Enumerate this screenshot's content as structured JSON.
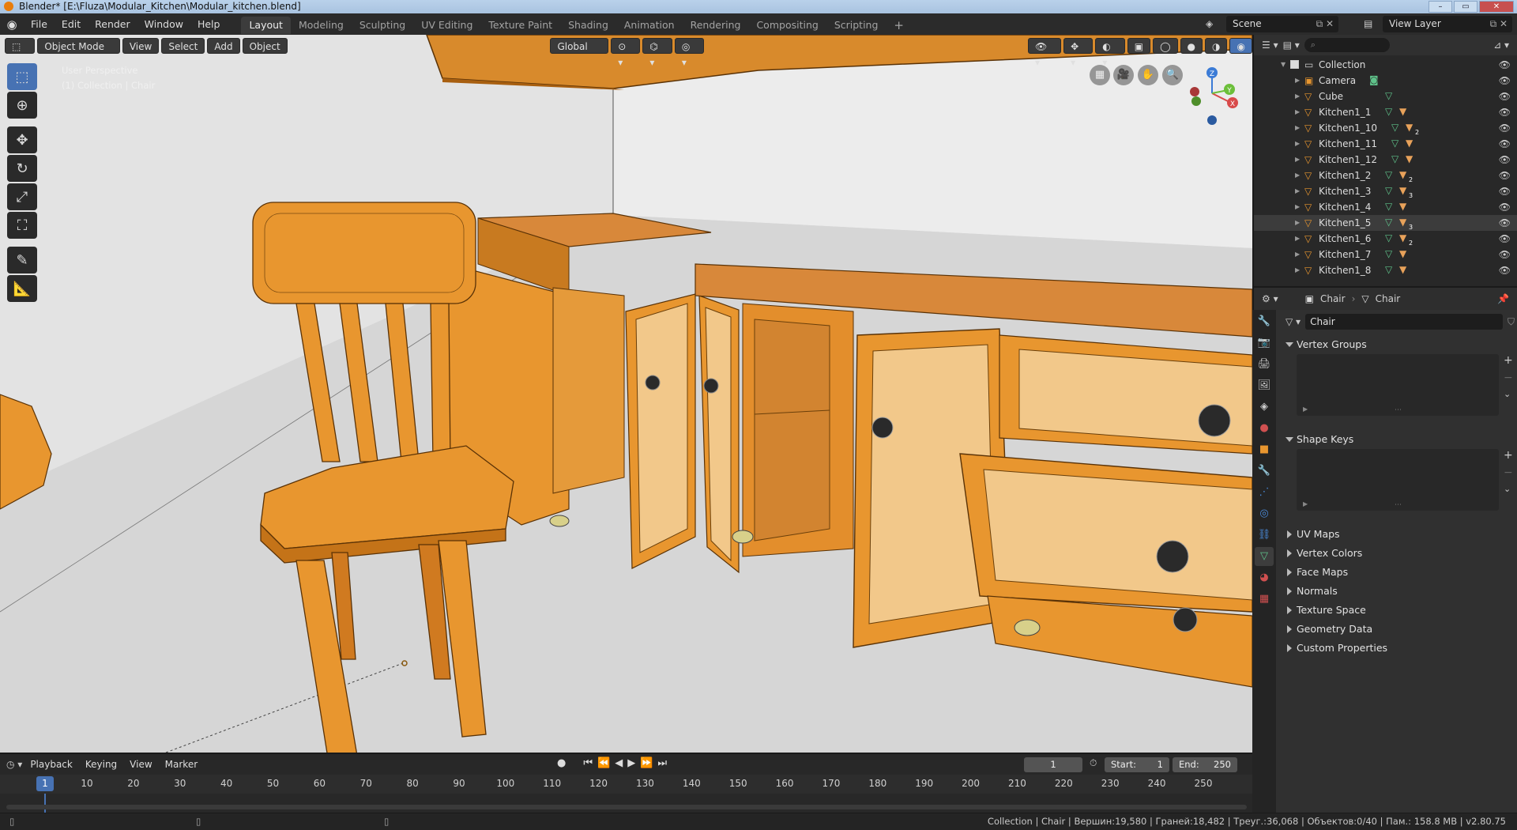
{
  "window": {
    "title": "Blender* [E:\\Fluza\\Modular_Kitchen\\Modular_kitchen.blend]"
  },
  "menus": [
    "File",
    "Edit",
    "Render",
    "Window",
    "Help"
  ],
  "workspaces": [
    {
      "label": "Layout",
      "active": true
    },
    {
      "label": "Modeling"
    },
    {
      "label": "Sculpting"
    },
    {
      "label": "UV Editing"
    },
    {
      "label": "Texture Paint"
    },
    {
      "label": "Shading"
    },
    {
      "label": "Animation"
    },
    {
      "label": "Rendering"
    },
    {
      "label": "Compositing"
    },
    {
      "label": "Scripting"
    }
  ],
  "add_workspace": "+",
  "scene": {
    "name": "Scene",
    "view_layer": "View Layer"
  },
  "viewport": {
    "mode": "Object Mode",
    "menus": [
      "View",
      "Select",
      "Add",
      "Object"
    ],
    "orientation": "Global",
    "overlay_text_1": "User Perspective",
    "overlay_text_2": "(1) Collection | Chair",
    "gizmo_axes": {
      "x": "X",
      "y": "Y",
      "z": "Z"
    },
    "colors": {
      "wood": "#e8962f",
      "wood_dark": "#b86a14",
      "wood_light": "#f2c88a",
      "floor": "#d4d4d4",
      "wall": "#e6e6e6"
    }
  },
  "outliner": {
    "search_placeholder": "",
    "collection": "Collection",
    "items": [
      {
        "label": "Camera",
        "type": "camera"
      },
      {
        "label": "Cube",
        "type": "mesh"
      },
      {
        "label": "Kitchen1_1",
        "type": "mesh",
        "mods": ""
      },
      {
        "label": "Kitchen1_10",
        "type": "mesh",
        "mods": "2"
      },
      {
        "label": "Kitchen1_11",
        "type": "mesh",
        "mods": ""
      },
      {
        "label": "Kitchen1_12",
        "type": "mesh",
        "mods": ""
      },
      {
        "label": "Kitchen1_2",
        "type": "mesh",
        "mods": "2"
      },
      {
        "label": "Kitchen1_3",
        "type": "mesh",
        "mods": "3"
      },
      {
        "label": "Kitchen1_4",
        "type": "mesh",
        "mods": ""
      },
      {
        "label": "Kitchen1_5",
        "type": "mesh",
        "mods": "3",
        "selected": true
      },
      {
        "label": "Kitchen1_6",
        "type": "mesh",
        "mods": "2"
      },
      {
        "label": "Kitchen1_7",
        "type": "mesh",
        "mods": ""
      },
      {
        "label": "Kitchen1_8",
        "type": "mesh",
        "mods": ""
      }
    ]
  },
  "properties": {
    "breadcrumb_object": "Chair",
    "breadcrumb_data": "Chair",
    "data_name": "Chair",
    "panels": [
      {
        "label": "Vertex Groups",
        "open": true
      },
      {
        "label": "Shape Keys",
        "open": true
      },
      {
        "label": "UV Maps",
        "open": false
      },
      {
        "label": "Vertex Colors",
        "open": false
      },
      {
        "label": "Face Maps",
        "open": false
      },
      {
        "label": "Normals",
        "open": false
      },
      {
        "label": "Texture Space",
        "open": false
      },
      {
        "label": "Geometry Data",
        "open": false
      },
      {
        "label": "Custom Properties",
        "open": false
      }
    ]
  },
  "timeline": {
    "menus": [
      "Playback",
      "Keying",
      "View",
      "Marker"
    ],
    "current_frame": "1",
    "start_label": "Start:",
    "start": "1",
    "end_label": "End:",
    "end": "250",
    "ticks": [
      "1",
      "10",
      "20",
      "30",
      "40",
      "50",
      "60",
      "70",
      "80",
      "90",
      "100",
      "110",
      "120",
      "130",
      "140",
      "150",
      "160",
      "170",
      "180",
      "190",
      "200",
      "210",
      "220",
      "230",
      "240",
      "250"
    ]
  },
  "status": {
    "text": "Collection | Chair | Вершин:19,580 | Граней:18,482 | Треуг.:36,068 | Объектов:0/40 | Пам.: 158.8 MB | v2.80.75"
  }
}
